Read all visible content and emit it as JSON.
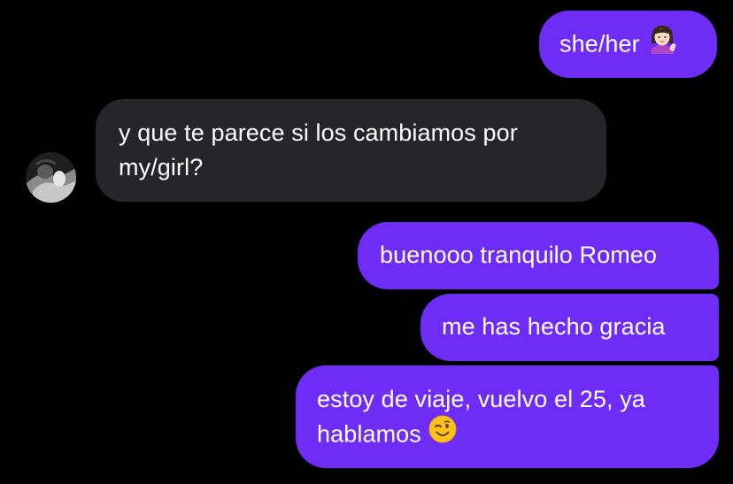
{
  "conversation": {
    "messages": [
      {
        "sender": "me",
        "text": "she/her",
        "emoji": "woman-tipping-hand-emoji"
      },
      {
        "sender": "other",
        "line1": "y que te parece si los cambiamos por",
        "line2": "my/girl?"
      },
      {
        "sender": "me",
        "text": "buenooo tranquilo Romeo"
      },
      {
        "sender": "me",
        "text": "me has hecho gracia"
      },
      {
        "sender": "me",
        "line1": "estoy de viaje, vuelvo el 25, ya",
        "line2": "hablamos",
        "emoji": "winking-face-emoji"
      }
    ]
  },
  "colors": {
    "background": "#000000",
    "outgoing_bubble": "#6f2cf6",
    "incoming_bubble": "#262628",
    "text": "#ffffff"
  }
}
